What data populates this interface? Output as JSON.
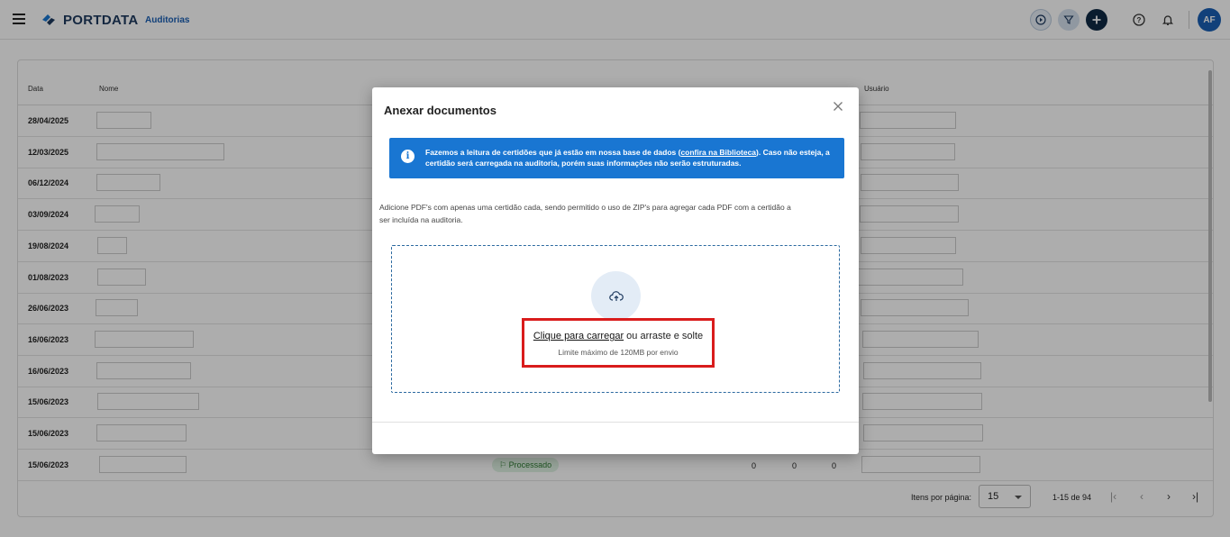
{
  "app": {
    "brand": "PORTDATA",
    "module": "Auditorias",
    "avatar_initials": "AF",
    "colors": {
      "primary": "#1976d2",
      "dark": "#0f2a44",
      "highlight": "#d91c1c",
      "status_green": "#2e7d32"
    }
  },
  "table": {
    "headers": {
      "date": "Data",
      "name": "Nome",
      "user": "Usuário"
    },
    "rows": [
      {
        "date": "28/04/2025"
      },
      {
        "date": "12/03/2025"
      },
      {
        "date": "06/12/2024"
      },
      {
        "date": "03/09/2024"
      },
      {
        "date": "19/08/2024"
      },
      {
        "date": "01/08/2023"
      },
      {
        "date": "26/06/2023"
      },
      {
        "date": "16/06/2023"
      },
      {
        "date": "16/06/2023"
      },
      {
        "date": "15/06/2023"
      },
      {
        "date": "15/06/2023"
      },
      {
        "date": "15/06/2023",
        "status": "Processado",
        "n1": "0",
        "n2": "0",
        "n3": "0"
      }
    ]
  },
  "paginator": {
    "items_label": "Itens por página:",
    "page_size": "15",
    "range": "1-15 de 94"
  },
  "modal": {
    "title": "Anexar documentos",
    "info_text_before": "Fazemos a leitura de certidões que já estão em nossa base de dados (",
    "info_link": "confira na Biblioteca",
    "info_text_after": "). Caso não esteja, a certidão será carregada na auditoria, porém suas informações não serão estruturadas.",
    "hint": "Adicione PDF's com apenas uma certidão cada, sendo permitido o uso de ZIP's para agregar cada PDF com a certidão a ser incluída na auditoria.",
    "upload_link": "Clique para carregar",
    "upload_rest": " ou arraste e solte",
    "limit": "Limite máximo de 120MB por envio"
  },
  "icons": {
    "menu": "hamburger-icon",
    "play": "play-circle-icon",
    "filter": "filter-icon",
    "add": "plus-icon",
    "help": "help-icon",
    "bell": "bell-icon",
    "close": "close-icon",
    "info": "info-icon",
    "upload": "cloud-upload-icon"
  }
}
